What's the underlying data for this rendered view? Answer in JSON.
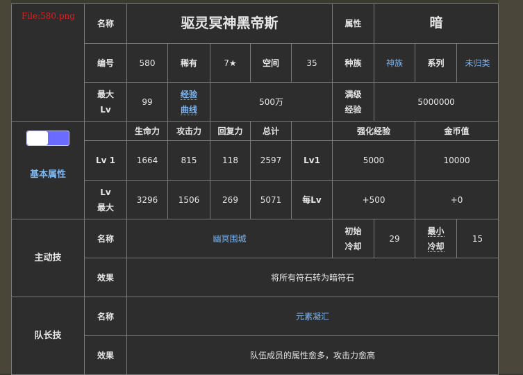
{
  "file_link": "File:580.png",
  "labels": {
    "name": "名称",
    "attribute": "属性",
    "number": "编号",
    "rarity": "稀有",
    "cost": "空间",
    "race": "种族",
    "series": "系列",
    "max_lv_1": "最大",
    "max_lv_2": "Lv",
    "exp_curve_1": "经验",
    "exp_curve_2": "曲线",
    "max_exp_1": "满级",
    "max_exp_2": "经验"
  },
  "monster": {
    "name": "驱灵冥神黑帝斯",
    "attribute": "暗",
    "number": "580",
    "rarity": "7★",
    "cost": "35",
    "race": "神族",
    "series": "未归类",
    "max_lv": "99",
    "exp_curve": "500万",
    "max_exp": "5000000"
  },
  "stats": {
    "section_label": "基本属性",
    "headers": {
      "hp": "生命力",
      "atk": "攻击力",
      "rec": "回复力",
      "total": "总计",
      "exp": "强化经验",
      "coin": "金币值"
    },
    "lv1": {
      "label": "Lv 1",
      "hp": "1664",
      "atk": "815",
      "rec": "118",
      "total": "2597",
      "exp_label": "Lv1",
      "exp": "5000",
      "coin": "10000"
    },
    "lvmax": {
      "label_1": "Lv",
      "label_2": "最大",
      "hp": "3296",
      "atk": "1506",
      "rec": "269",
      "total": "5071",
      "exp_label": "每Lv",
      "exp": "+500",
      "coin": "+0"
    }
  },
  "active_skill": {
    "section_label": "主动技",
    "name_label": "名称",
    "name": "幽冥围城",
    "init_cd_label_1": "初始",
    "init_cd_label_2": "冷却",
    "init_cd": "29",
    "min_cd_label_1": "最小",
    "min_cd_label_2": "冷却",
    "min_cd": "15",
    "effect_label": "效果",
    "effect": "将所有符石转为暗符石"
  },
  "leader_skill": {
    "section_label": "队长技",
    "name_label": "名称",
    "name": "元素凝汇",
    "effect_label": "效果",
    "effect": "队伍成员的属性愈多，攻击力愈高"
  },
  "colors": {
    "link": "#7fb6f0",
    "side_panel": "#5a4d5f",
    "toggle": "#6b6bff",
    "file_link": "#e21e1e"
  }
}
